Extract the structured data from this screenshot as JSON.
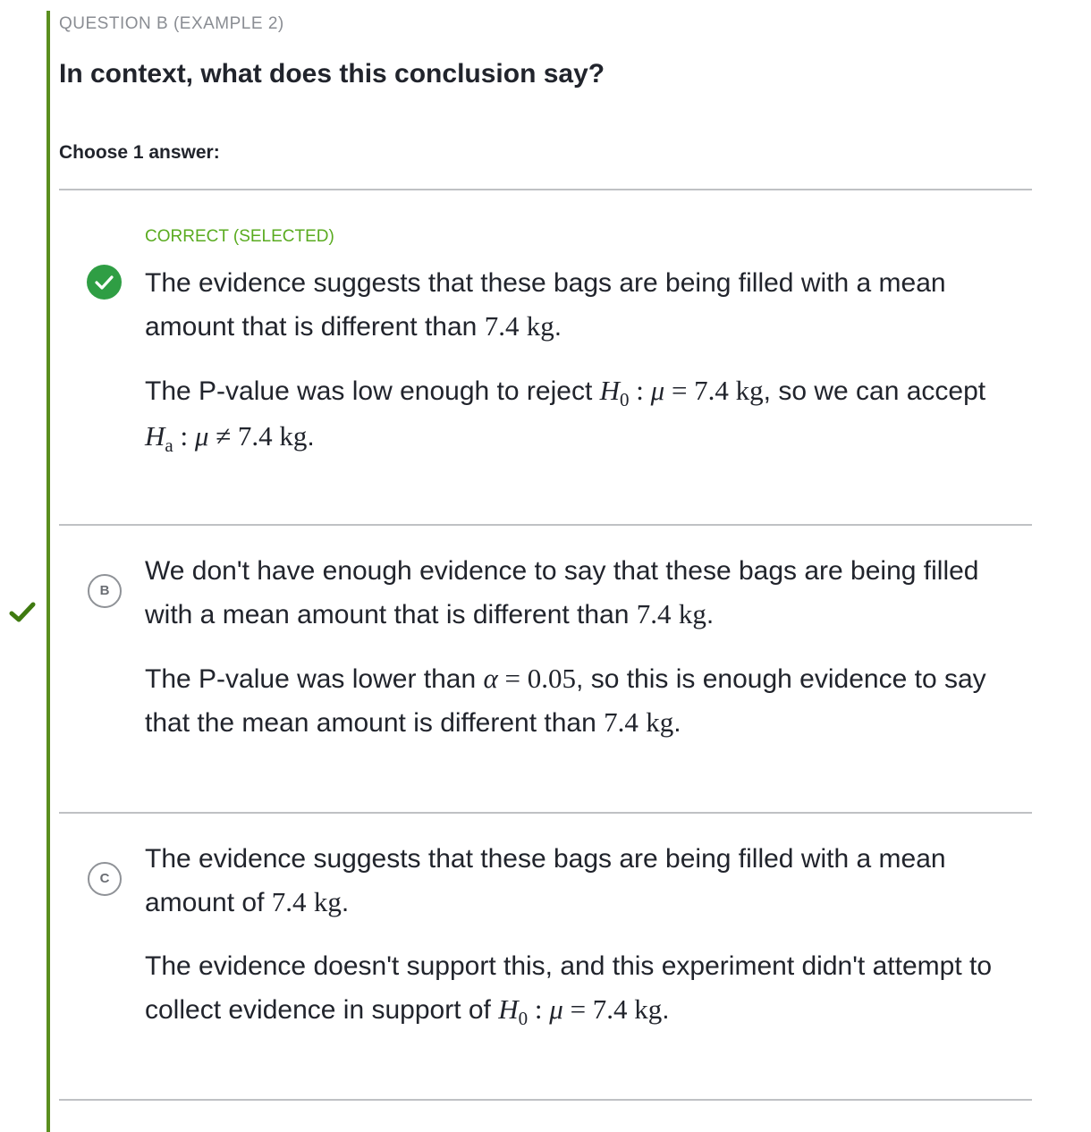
{
  "header": {
    "question_label": "QUESTION B (EXAMPLE 2)",
    "title": "In context, what does this conclusion say?",
    "choose_label": "Choose 1 answer:"
  },
  "colors": {
    "accent_bar": "#5a8f1f",
    "correct_status": "#5aab20",
    "check_circle": "#2f9e44",
    "side_check": "#3f7a10",
    "divider": "#bfc1c4"
  },
  "icons": {
    "selected_check": "check-circle-icon",
    "side_correct_marker": "checkmark-icon"
  },
  "options": [
    {
      "letter": "A",
      "status": "CORRECT (SELECTED)",
      "p1_text_a": "The evidence suggests that these bags are being filled with a mean amount that is different than ",
      "p1_num": "7.4",
      "p1_unit": "kg",
      "p1_end": ".",
      "p2_text_a": "The P-value was low enough to reject ",
      "p2_H": "H",
      "p2_H_sub": "0",
      "p2_colon": " : ",
      "p2_mu": "μ",
      "p2_eq": " = 7.4 ",
      "p2_unit": "kg",
      "p2_text_b": ", so we can accept ",
      "p2_Ha": "H",
      "p2_Ha_sub": "a",
      "p2_colon2": " : ",
      "p2_mu2": "μ",
      "p2_neq": " ≠ 7.4 ",
      "p2_unit2": "kg",
      "p2_end": "."
    },
    {
      "letter": "B",
      "p1_text_a": "We don't have enough evidence to say that these bags are being filled with a mean amount that is different than ",
      "p1_num": "7.4",
      "p1_unit": "kg",
      "p1_end": ".",
      "p2_text_a": "The P-value was lower than ",
      "p2_alpha": "α",
      "p2_eq": " = 0.05",
      "p2_text_b": ", so this is enough evidence to say that the mean amount is different than ",
      "p2_num": "7.4",
      "p2_unit": "kg",
      "p2_end": "."
    },
    {
      "letter": "C",
      "p1_text_a": "The evidence suggests that these bags are being filled with a mean amount of ",
      "p1_num": "7.4",
      "p1_unit": "kg",
      "p1_end": ".",
      "p2_text_a": "The evidence doesn't support this, and this experiment didn't attempt to collect evidence in support of ",
      "p2_H": "H",
      "p2_H_sub": "0",
      "p2_colon": " : ",
      "p2_mu": "μ",
      "p2_eq": " = 7.4 ",
      "p2_unit": "kg",
      "p2_end": "."
    }
  ]
}
